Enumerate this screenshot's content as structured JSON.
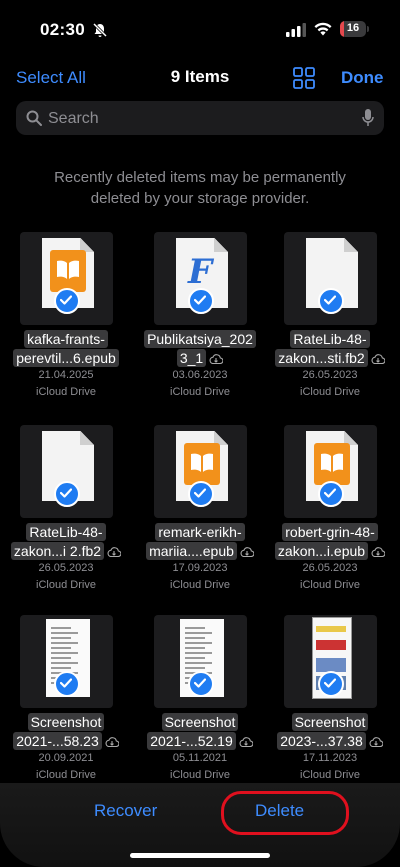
{
  "status_bar": {
    "time": "02:30",
    "battery": "16",
    "battery_level": 0.16
  },
  "nav": {
    "select_all": "Select All",
    "title": "9 Items",
    "done": "Done"
  },
  "search": {
    "placeholder": "Search"
  },
  "notice": "Recently deleted items may be permanently deleted by your storage provider.",
  "files": [
    {
      "line1": "kafka-frants-",
      "line2": "perevtil...6.epub",
      "date": "21.04.2025",
      "location": "iCloud Drive",
      "thumb": "book",
      "cloud": false
    },
    {
      "line1": "Publikatsiya_202",
      "line2": "3_1",
      "date": "03.06.2023",
      "location": "iCloud Drive",
      "thumb": "f-doc",
      "cloud": true
    },
    {
      "line1": "RateLib-48-",
      "line2": "zakon...sti.fb2",
      "date": "26.05.2023",
      "location": "iCloud Drive",
      "thumb": "blank",
      "cloud": true
    },
    {
      "line1": "RateLib-48-",
      "line2": "zakon...i 2.fb2",
      "date": "26.05.2023",
      "location": "iCloud Drive",
      "thumb": "blank",
      "cloud": true
    },
    {
      "line1": "remark-erikh-",
      "line2": "mariia....epub",
      "date": "17.09.2023",
      "location": "iCloud Drive",
      "thumb": "book",
      "cloud": true
    },
    {
      "line1": "robert-grin-48-",
      "line2": "zakon...i.epub",
      "date": "26.05.2023",
      "location": "iCloud Drive",
      "thumb": "book",
      "cloud": true
    },
    {
      "line1": "Screenshot",
      "line2": "2021-...58.23",
      "date": "20.09.2021",
      "location": "iCloud Drive",
      "thumb": "page",
      "cloud": true
    },
    {
      "line1": "Screenshot",
      "line2": "2021-...52.19",
      "date": "05.11.2021",
      "location": "iCloud Drive",
      "thumb": "page",
      "cloud": true
    },
    {
      "line1": "Screenshot",
      "line2": "2023-...37.38",
      "date": "17.11.2023",
      "location": "iCloud Drive",
      "thumb": "phone",
      "cloud": true
    }
  ],
  "bottom_bar": {
    "recover": "Recover",
    "delete": "Delete"
  },
  "colors": {
    "accent": "#3e8cff",
    "check": "#1f7cf2",
    "highlight_ring": "#e0101e",
    "book": "#f2911b"
  }
}
